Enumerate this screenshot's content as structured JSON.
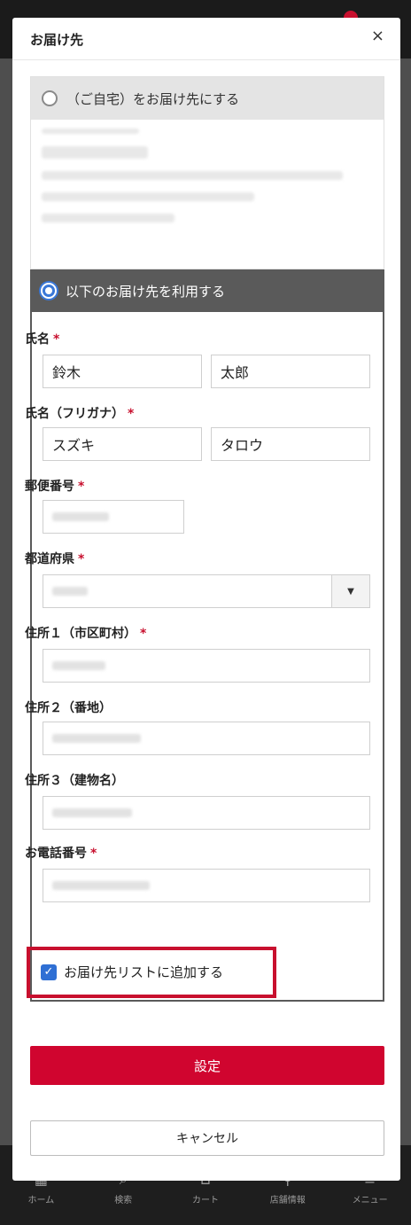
{
  "modal": {
    "title": "お届け先",
    "close_label": "×"
  },
  "home_option": {
    "label": "（ご自宅）をお届け先にする"
  },
  "new_option": {
    "label": "以下のお届け先を利用する"
  },
  "form": {
    "required_mark": "*",
    "name_label": "氏名",
    "last_name_value": "鈴木",
    "first_name_value": "太郎",
    "kana_label": "氏名（フリガナ）",
    "last_kana_value": "スズキ",
    "first_kana_value": "タロウ",
    "postal_label": "郵便番号",
    "prefecture_label": "都道府県",
    "address1_label": "住所１（市区町村）",
    "address2_label": "住所２（番地）",
    "address3_label": "住所３（建物名）",
    "phone_label": "お電話番号",
    "select_arrow": "▼"
  },
  "save_to_list": {
    "label": "お届け先リストに追加する",
    "checked": true,
    "check_glyph": "✓"
  },
  "buttons": {
    "submit": "設定",
    "cancel": "キャンセル"
  },
  "bottom_nav": {
    "items": [
      {
        "label": "ホーム",
        "icon": "home-icon",
        "glyph": "▦"
      },
      {
        "label": "検索",
        "icon": "search-icon",
        "glyph": "⌕"
      },
      {
        "label": "カート",
        "icon": "cart-icon",
        "glyph": "⊔"
      },
      {
        "label": "店舗情報",
        "icon": "store-pin-icon",
        "glyph": "⚲"
      },
      {
        "label": "メニュー",
        "icon": "menu-icon",
        "glyph": "≡"
      }
    ]
  },
  "colors": {
    "accent_red": "#d0052f",
    "radio_blue": "#3a78d8",
    "header_gray": "#5a5a5a"
  }
}
